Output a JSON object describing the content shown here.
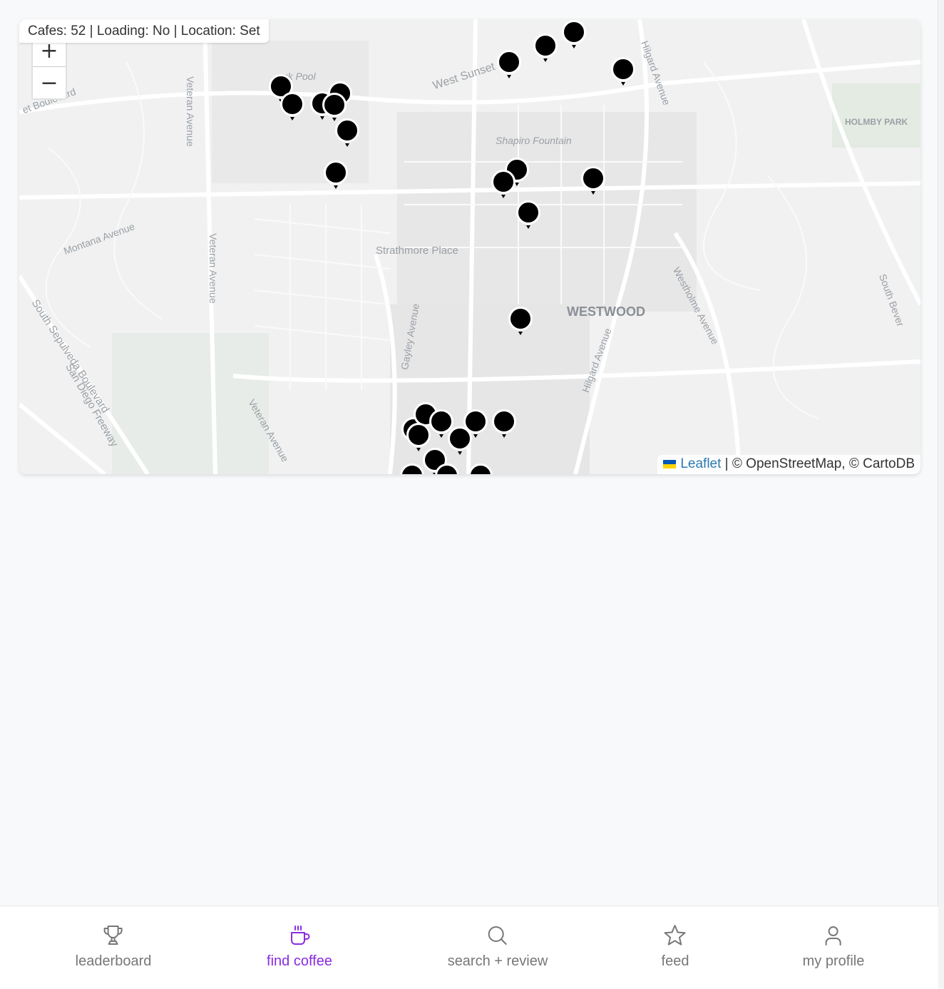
{
  "status_bar": "Cafes: 52 | Loading: No | Location: Set",
  "zoom": {
    "in_label": "+",
    "out_label": "−"
  },
  "map_labels": {
    "pool": "rk Pool",
    "west_sunset": "West Sunset Bou",
    "boulevard": "et Boulevard",
    "veteran1": "Veteran Avenue",
    "veteran2": "Veteran Avenue",
    "veteran3": "Veteran Avenue",
    "hilgard1": "Hilgard Avenue",
    "hilgard2": "Hilgard Avenue",
    "shapiro": "Shapiro Fountain",
    "holmby": "HOLMBY PARK",
    "montana": "Montana Avenue",
    "strathmore": "Strathmore Place",
    "westwood": "WESTWOOD",
    "westholme": "Westholme Avenue",
    "south_bev": "South Bever",
    "gayley": "Gayley Avenue",
    "sepulveda": "South Sepulveda Boulevard",
    "san_diego": "San Diego Freeway"
  },
  "attribution": {
    "leaflet": "Leaflet",
    "rest": "© OpenStreetMap, © CartoDB",
    "separator": "|",
    "flag_colors": [
      "#0057b7",
      "#ffd500"
    ]
  },
  "markers": 52,
  "nav": {
    "items": [
      {
        "label": "leaderboard",
        "icon": "trophy-icon"
      },
      {
        "label": "find coffee",
        "icon": "coffee-cup-icon",
        "active": true
      },
      {
        "label": "search + review",
        "icon": "search-icon"
      },
      {
        "label": "feed",
        "icon": "star-icon"
      },
      {
        "label": "my profile",
        "icon": "user-icon"
      }
    ],
    "active_color": "#8a2be2",
    "inactive_color": "#777777"
  }
}
